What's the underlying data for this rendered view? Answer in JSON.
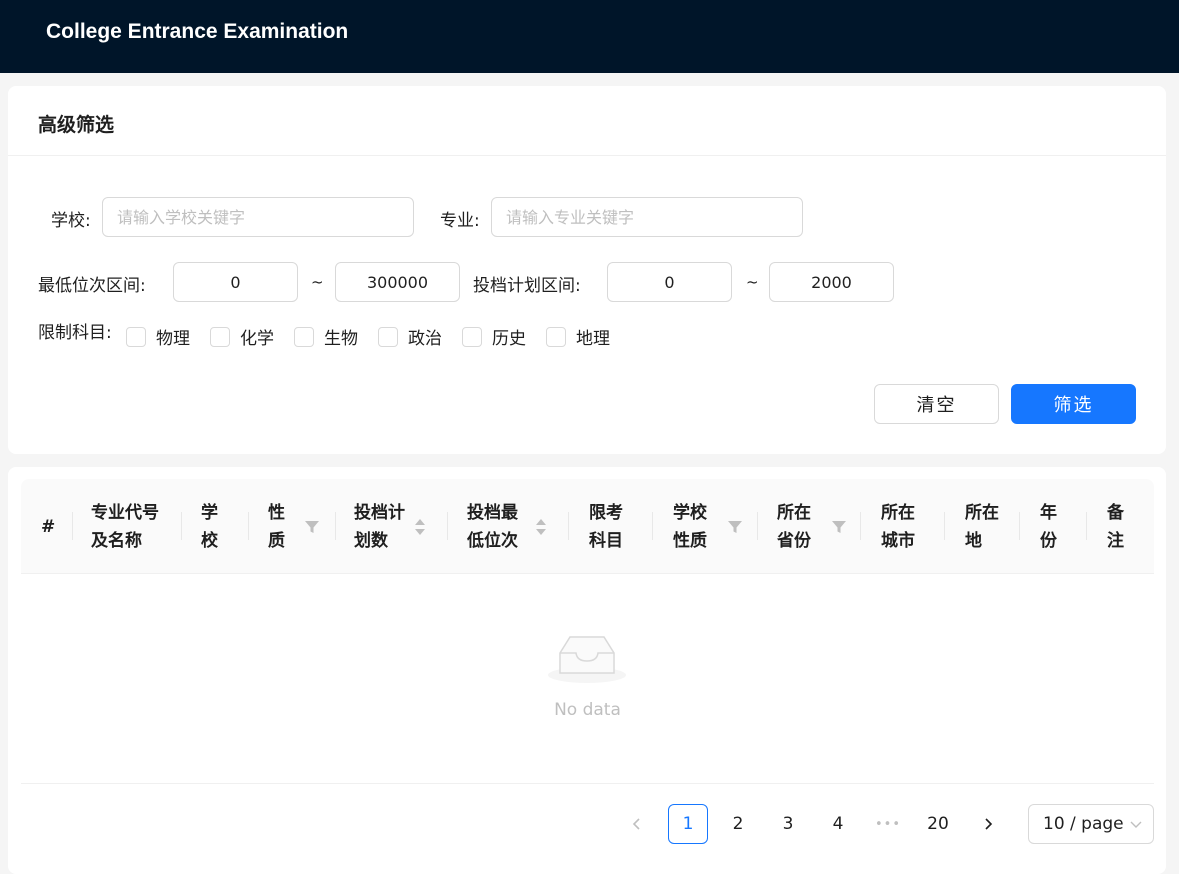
{
  "app": {
    "title": "College Entrance Examination"
  },
  "filter": {
    "title": "高级筛选",
    "school_label": "学校:",
    "school_placeholder": "请输入学校关键字",
    "major_label": "专业:",
    "major_placeholder": "请输入专业关键字",
    "rank_label": "最低位次区间:",
    "rank_min": "0",
    "rank_max": "300000",
    "plan_label": "投档计划区间:",
    "plan_min": "0",
    "plan_max": "2000",
    "tilde": "~",
    "subjects_label": "限制科目:",
    "subjects": [
      "物理",
      "化学",
      "生物",
      "政治",
      "历史",
      "地理"
    ],
    "clear_label": "清空",
    "submit_label": "筛选"
  },
  "table": {
    "columns": [
      {
        "label": "#"
      },
      {
        "label": "专业代号\n及名称"
      },
      {
        "label": "学\n校"
      },
      {
        "label": "性\n质",
        "filter": true
      },
      {
        "label": "投档计\n划数",
        "sorter": true
      },
      {
        "label": "投档最\n低位次",
        "sorter": true
      },
      {
        "label": "限考\n科目"
      },
      {
        "label": "学校\n性质",
        "filter": true
      },
      {
        "label": "所在\n省份",
        "filter": true
      },
      {
        "label": "所在\n城市"
      },
      {
        "label": "所在\n地"
      },
      {
        "label": "年\n份"
      },
      {
        "label": "备\n注"
      }
    ],
    "empty_text": "No data"
  },
  "pagination": {
    "pages": [
      "1",
      "2",
      "3",
      "4",
      "•••",
      "20"
    ],
    "current": "1",
    "page_size": "10 / page"
  },
  "colors": {
    "header_bg": "#001529",
    "primary": "#1677ff"
  }
}
